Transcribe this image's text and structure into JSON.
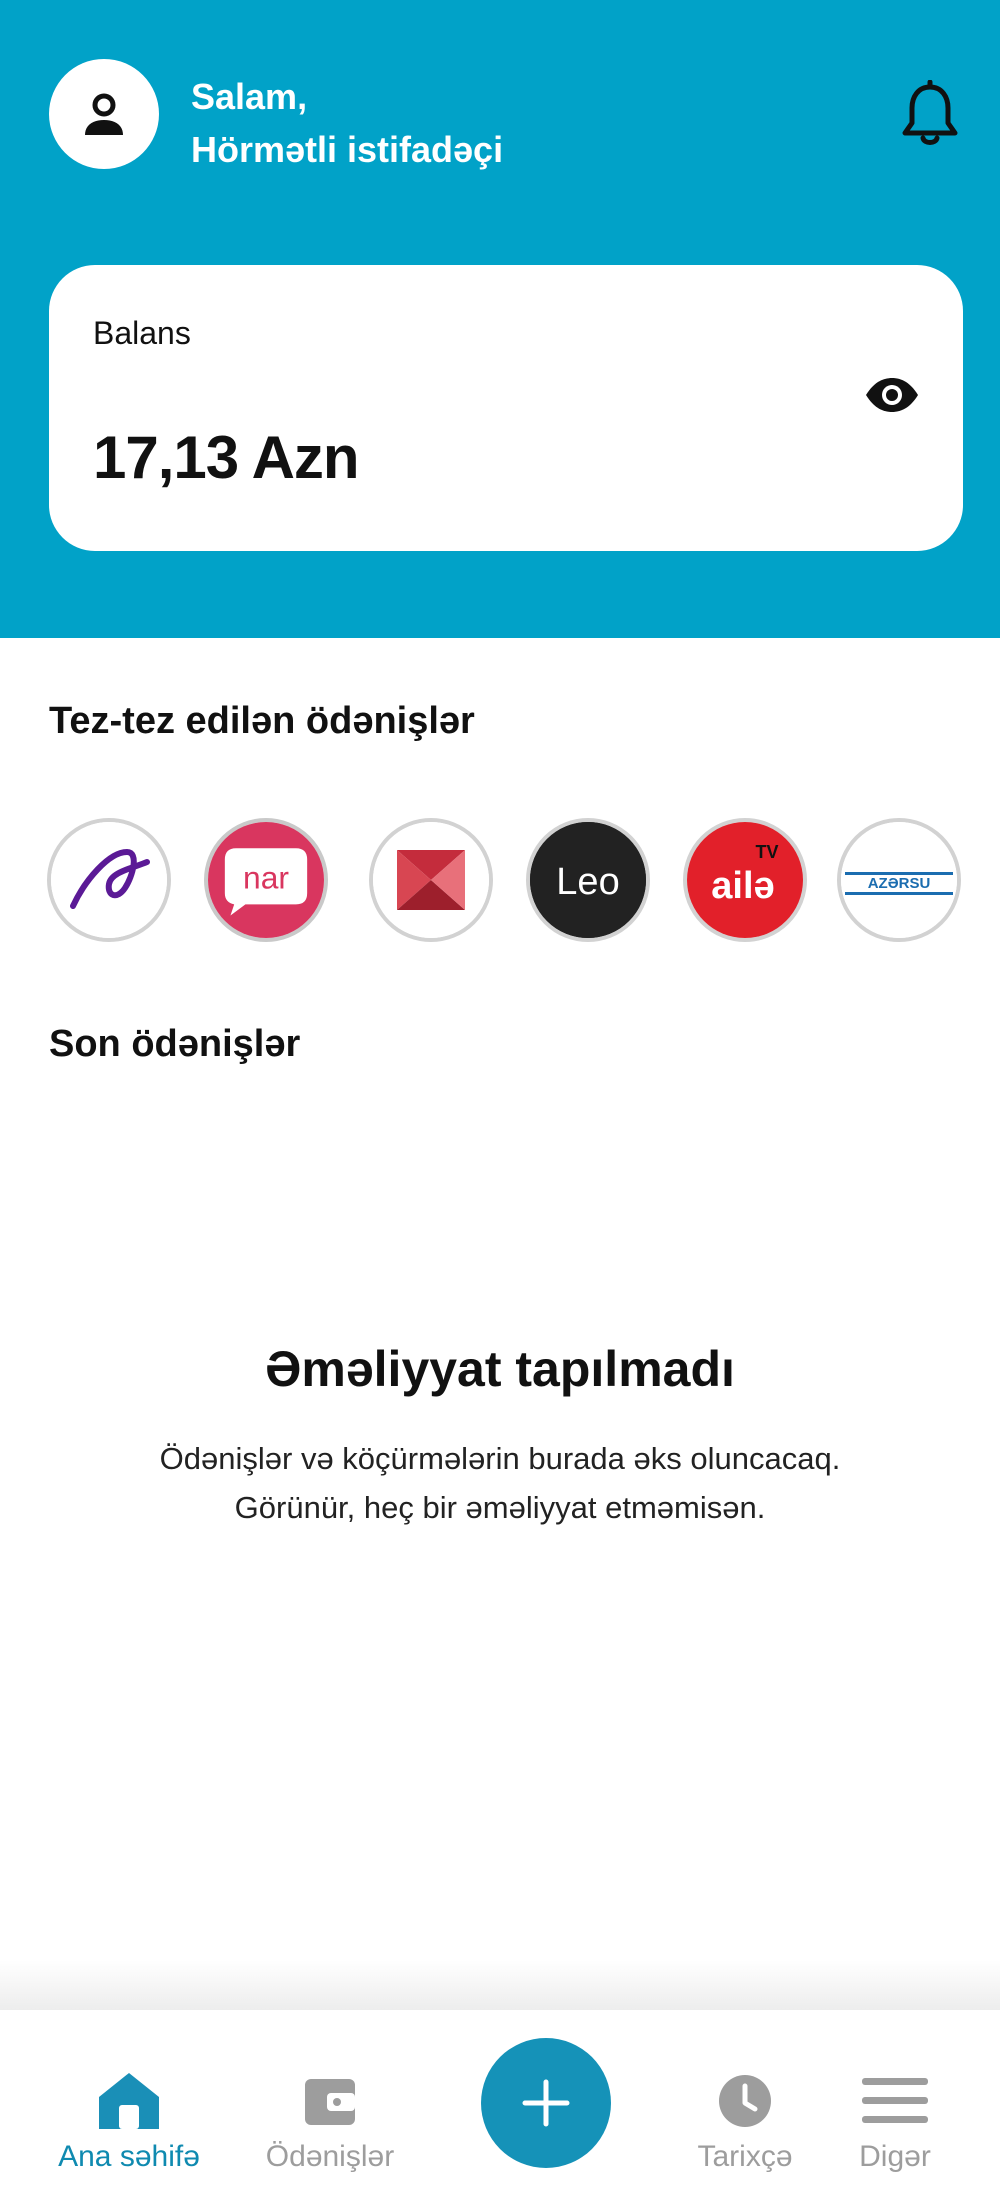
{
  "header": {
    "greeting_line1": "Salam,",
    "greeting_line2": "Hörmətli istifadəçi",
    "background_color": "#01a2c8",
    "avatar_icon": "user-icon",
    "notification_icon": "bell-icon"
  },
  "balance": {
    "label": "Balans",
    "value": "17,13 Azn",
    "visibility_icon": "eye-icon"
  },
  "quick_payments": {
    "title": "Tez-tez edilən ödənişlər",
    "items": [
      {
        "name": "azercell",
        "text": ""
      },
      {
        "name": "nar",
        "text": "nar"
      },
      {
        "name": "kapital",
        "text": ""
      },
      {
        "name": "leo",
        "text": "Leo"
      },
      {
        "name": "aile-tv",
        "text": "ailə"
      },
      {
        "name": "azersu",
        "text": "AZƏRSU"
      }
    ]
  },
  "recent_payments": {
    "title": "Son ödənişlər",
    "empty_title": "Əməliyyat tapılmadı",
    "empty_line1": "Ödənişlər və köçürmələrin burada əks oluncacaq.",
    "empty_line2": "Görünür, heç bir əməliyyat etməmisən."
  },
  "bottom_nav": {
    "active_color": "#0f8ab0",
    "items": [
      {
        "label": "Ana səhifə",
        "icon": "home-icon"
      },
      {
        "label": "Ödənişlər",
        "icon": "wallet-icon"
      },
      {
        "label": "",
        "icon": "plus-icon"
      },
      {
        "label": "Tarixçə",
        "icon": "clock-icon"
      },
      {
        "label": "Digər",
        "icon": "menu-icon"
      }
    ]
  }
}
